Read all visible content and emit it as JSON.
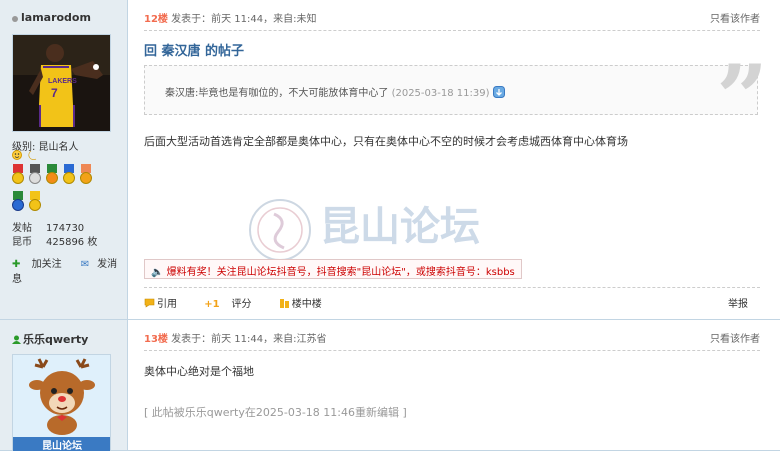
{
  "post1": {
    "author": "lamarodom",
    "level": "级别: 昆山名人",
    "stats": [
      {
        "k": "发帖",
        "v": "174730"
      },
      {
        "k": "昆币",
        "v": "425896 枚"
      }
    ],
    "actions": {
      "follow": "加关注",
      "message": "发消息"
    },
    "floor": "12楼",
    "meta": "发表于：前天 11:44，来自:未知",
    "only_author": "只看该作者",
    "title": "回 秦汉唐 的帖子",
    "quote_text": "秦汉唐:毕竟也是有咖位的，不大可能放体育中心了",
    "quote_time": "(2025-03-18 11:39)",
    "body": "后面大型活动首选肯定全部都是奥体中心，只有在奥体中心不空的时候才会考虑城西体育中心体育场",
    "ad": "爆料有奖！关注昆山论坛抖音号，抖音搜索\"昆山论坛\"，或搜索抖音号：ksbbs",
    "footer": {
      "quote": "引用",
      "rate": "评分",
      "floor_in_floor": "楼中楼",
      "report": "举报"
    },
    "watermark": "昆山论坛"
  },
  "post2": {
    "author": "乐乐qwerty",
    "avatar_caption": "昆山论坛",
    "floor": "13楼",
    "meta": "发表于：前天 11:44，来自:江苏省",
    "only_author": "只看该作者",
    "body": "奥体中心绝对是个福地",
    "edited": "[ 此帖被乐乐qwerty在2025-03-18 11:46重新编辑 ]"
  },
  "colors": {
    "floor": "#f26c4f",
    "title": "#336699",
    "sidebar": "#e5edf2",
    "border": "#c2d5e3"
  }
}
